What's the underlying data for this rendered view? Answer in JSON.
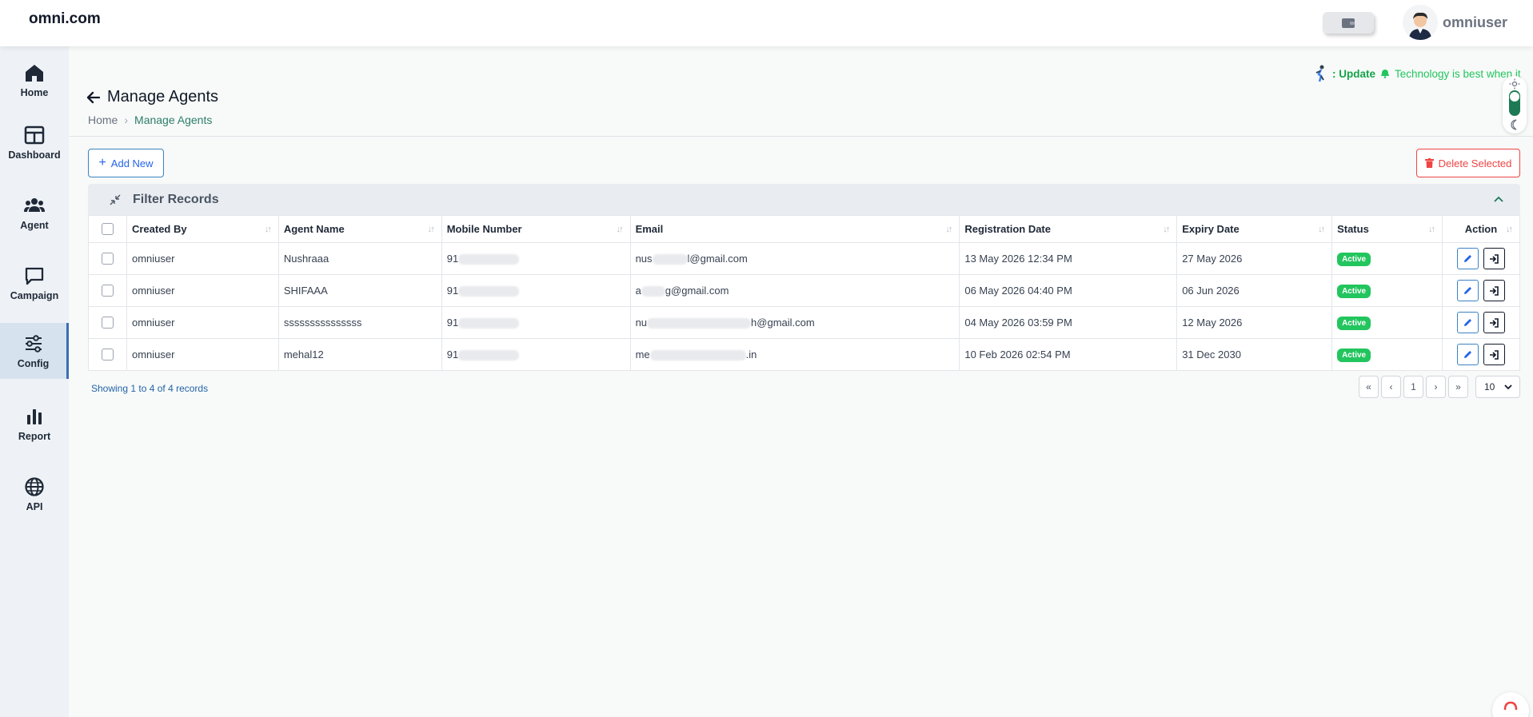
{
  "app": {
    "brand": "omni.com"
  },
  "header": {
    "username": "omniuser"
  },
  "sidebar": {
    "items": [
      {
        "label": "Home",
        "icon": "home-icon"
      },
      {
        "label": "Dashboard",
        "icon": "dashboard-icon"
      },
      {
        "label": "Agent",
        "icon": "users-icon"
      },
      {
        "label": "Campaign",
        "icon": "chat-icon"
      },
      {
        "label": "Config",
        "icon": "sliders-icon",
        "active": true
      },
      {
        "label": "Report",
        "icon": "bar-chart-icon"
      },
      {
        "label": "API",
        "icon": "globe-icon"
      }
    ]
  },
  "notice": {
    "prefix": ": Update",
    "text": "Technology is best when it"
  },
  "page": {
    "title": "Manage Agents",
    "breadcrumb": {
      "home": "Home",
      "current": "Manage Agents"
    }
  },
  "toolbar": {
    "add_label": "Add New",
    "delete_label": "Delete Selected"
  },
  "filter": {
    "title": "Filter Records"
  },
  "table": {
    "columns": [
      "Created By",
      "Agent Name",
      "Mobile Number",
      "Email",
      "Registration Date",
      "Expiry Date",
      "Status",
      "Action"
    ],
    "rows": [
      {
        "created_by": "omniuser",
        "agent_name": "Nushraaa",
        "mobile_prefix": "91",
        "email_start": "nus",
        "email_end": "l@gmail.com",
        "registration": "13 May 2026 12:34 PM",
        "expiry": "27 May 2026",
        "status": "Active"
      },
      {
        "created_by": "omniuser",
        "agent_name": "SHIFAAA",
        "mobile_prefix": "91",
        "email_start": "a",
        "email_end": "g@gmail.com",
        "registration": "06 May 2026 04:40 PM",
        "expiry": "06 Jun 2026",
        "status": "Active"
      },
      {
        "created_by": "omniuser",
        "agent_name": "sssssssssssssss",
        "mobile_prefix": "91",
        "email_start": "nu",
        "email_end": "h@gmail.com",
        "registration": "04 May 2026 03:59 PM",
        "expiry": "12 May 2026",
        "status": "Active"
      },
      {
        "created_by": "omniuser",
        "agent_name": "mehal12",
        "mobile_prefix": "91",
        "email_start": "me",
        "email_end": ".in",
        "registration": "10 Feb 2026 02:54 PM",
        "expiry": "31 Dec 2030",
        "status": "Active"
      }
    ]
  },
  "pagination": {
    "summary": "Showing 1 to 4 of 4 records",
    "first": "«",
    "prev": "‹",
    "page": "1",
    "next": "›",
    "last": "»",
    "page_size": "10"
  },
  "colors": {
    "accent": "#2563eb",
    "danger": "#ef4444",
    "success": "#22c55e",
    "brand_green": "#1d7a55"
  }
}
